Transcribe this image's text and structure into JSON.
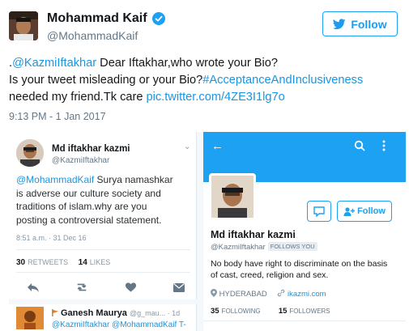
{
  "header": {
    "display_name": "Mohammad Kaif",
    "handle": "@MohammadKaif",
    "follow_label": "Follow"
  },
  "tweet": {
    "line1_prefix": ".",
    "line1_mention": "@KazmiIftakhar",
    "line1_rest": " Dear Iftakhar,who wrote your Bio?",
    "line2_text": "Is your tweet misleading or your Bio?",
    "line2_hashtag": "#AcceptanceAndInclusiveness",
    "line3_text": "needed my friend.Tk care ",
    "line3_link": "pic.twitter.com/4ZE3I1lg7o",
    "timestamp": "9:13 PM - 1 Jan 2017"
  },
  "embedded_tweet": {
    "name": "Md iftakhar kazmi",
    "handle": "@KazmiIftakhar",
    "mention": "@MohammadKaif",
    "text_line1_rest": " Surya namashkar",
    "text_line2": "is adverse our culture society and",
    "text_line3": "traditions of islam.why are you",
    "text_line4": "posting a controversial statement.",
    "time": "8:51 a.m. · 31 Dec 16",
    "retweets_count": "30",
    "retweets_label": "RETWEETS",
    "likes_count": "14",
    "likes_label": "LIKES",
    "reply_name": "Ganesh Maurya",
    "reply_meta": "@g_mau... · 1d",
    "reply_text": "@KazmiIftakhar @MohammadKaif T-"
  },
  "embedded_profile": {
    "name": "Md iftakhar kazmi",
    "handle": "@KazmiIftakhar",
    "follows_you": "FOLLOWS YOU",
    "follow_label": "Follow",
    "bio_line1": "No body have right to discriminate on the basis",
    "bio_line2": "of cast, creed, religion and sex.",
    "location": "HYDERABAD",
    "website": "ikazmi.com",
    "following_count": "35",
    "following_label": "FOLLOWING",
    "followers_count": "15",
    "followers_label": "FOLLOWERS"
  },
  "colors": {
    "twitter_blue": "#1da1f2",
    "link_blue": "#1b95e0",
    "text_dark": "#14171a",
    "text_gray": "#657786"
  }
}
